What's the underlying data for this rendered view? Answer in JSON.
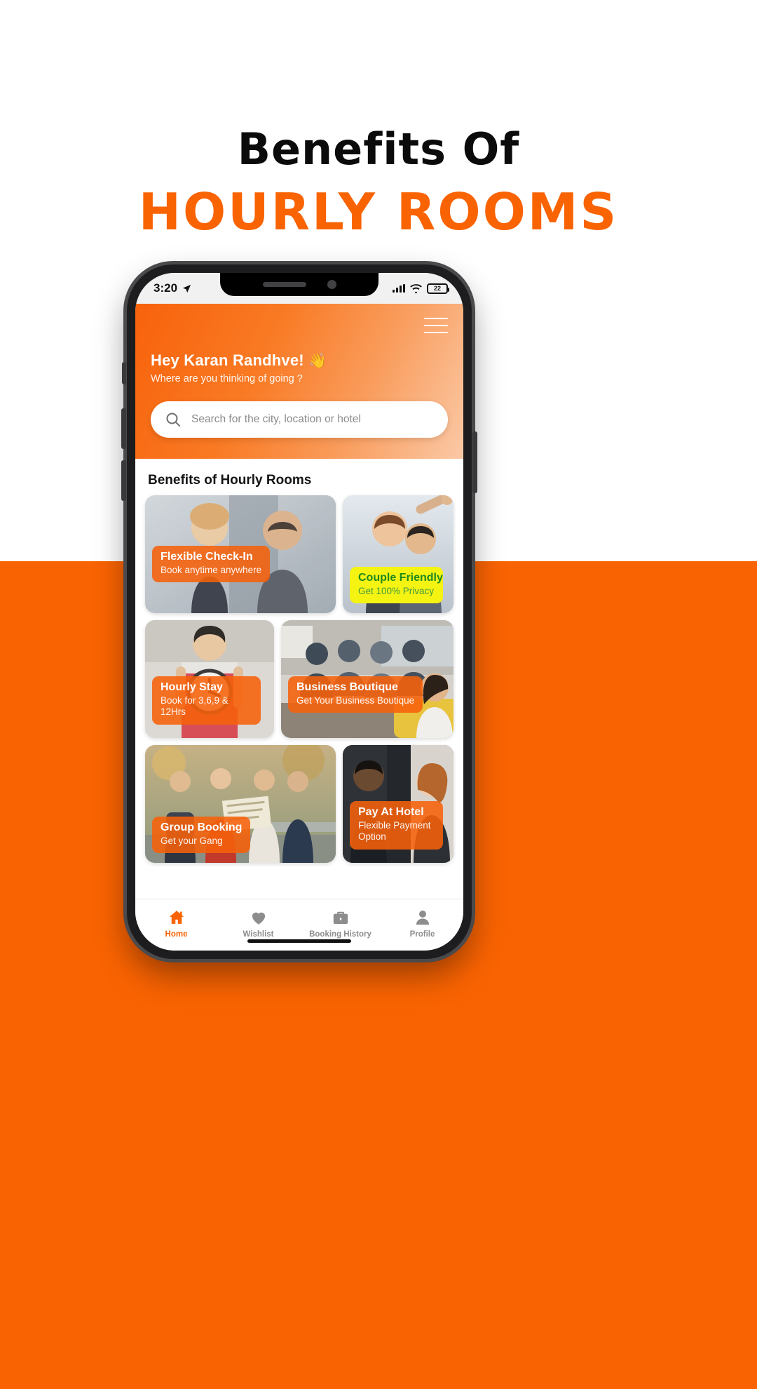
{
  "poster": {
    "title_line1": "Benefits Of",
    "title_line2": "HOURLY ROOMS",
    "accent_color": "#F96302",
    "title_color": "#0b0b0b",
    "bg_top_color": "#ffffff",
    "bg_bottom_color": "#F96302"
  },
  "status_bar": {
    "time": "3:20",
    "location_icon": "location-arrow-icon",
    "signal_icon": "cellular-signal-icon",
    "wifi_icon": "wifi-icon",
    "battery_icon": "battery-icon",
    "battery_level": "22"
  },
  "header": {
    "menu_icon": "hamburger-menu-icon",
    "greeting": "Hey Karan Randhve!",
    "wave_emoji": "👋",
    "subgreeting": "Where are you thinking of going ?",
    "search_icon": "search-icon",
    "search_placeholder": "Search for the city, location or hotel",
    "search_value": ""
  },
  "content": {
    "section_title": "Benefits of Hourly Rooms",
    "cards": [
      {
        "id": "flexible-check-in",
        "title": "Flexible Check-In",
        "subtitle": "Book anytime anywhere",
        "label_style": "orange"
      },
      {
        "id": "couple-friendly",
        "title": "Couple Friendly",
        "subtitle": "Get 100% Privacy",
        "label_style": "yellow"
      },
      {
        "id": "hourly-stay",
        "title": "Hourly Stay",
        "subtitle": "Book for 3,6,9 & 12Hrs",
        "label_style": "orange"
      },
      {
        "id": "business-boutique",
        "title": "Business Boutique",
        "subtitle": "Get Your Business Boutique",
        "label_style": "orange"
      },
      {
        "id": "group-booking",
        "title": "Group Booking",
        "subtitle": "Get your Gang",
        "label_style": "orange"
      },
      {
        "id": "pay-at-hotel",
        "title": "Pay At Hotel",
        "subtitle": "Flexible Payment Option",
        "label_style": "orange"
      }
    ]
  },
  "bottom_nav": {
    "items": [
      {
        "label": "Home",
        "icon": "home-icon",
        "active": true
      },
      {
        "label": "Wishlist",
        "icon": "heart-icon",
        "active": false
      },
      {
        "label": "Booking History",
        "icon": "briefcase-icon",
        "active": false
      },
      {
        "label": "Profile",
        "icon": "person-icon",
        "active": false
      }
    ]
  }
}
